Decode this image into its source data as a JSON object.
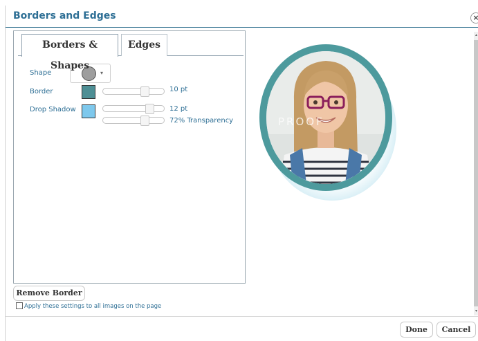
{
  "dialog": {
    "title": "Borders and Edges",
    "close_glyph": "×"
  },
  "tabs": [
    {
      "label": "Borders & Shapes",
      "active": true
    },
    {
      "label": "Edges",
      "active": false
    }
  ],
  "settings": {
    "shape": {
      "label": "Shape",
      "value_icon": "circle-shape-icon",
      "caret_glyph": "▾"
    },
    "border": {
      "label": "Border",
      "color": "#4e8f95",
      "size_value": 0.72,
      "size_text": "10 pt"
    },
    "drop_shadow": {
      "label": "Drop Shadow",
      "color": "#7ec8ec",
      "size_value": 0.82,
      "size_text": "12 pt",
      "transparency_value": 0.72,
      "transparency_text": "72% Transparency"
    }
  },
  "actions": {
    "remove_border": "Remove Border",
    "apply_all_label": "Apply these settings to all images on the page",
    "apply_all_checked": false,
    "done": "Done",
    "cancel": "Cancel"
  },
  "preview": {
    "watermark": "PROOF",
    "frame_color": "#4d9a9d"
  },
  "scrollbar": {
    "up_glyph": "▴",
    "down_glyph": "▾"
  }
}
